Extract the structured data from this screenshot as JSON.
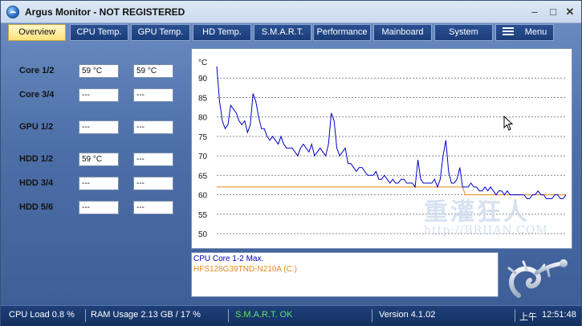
{
  "window": {
    "title": "Argus Monitor - NOT REGISTERED"
  },
  "tabs": [
    {
      "label": "Overview",
      "active": true
    },
    {
      "label": "CPU Temp.",
      "active": false
    },
    {
      "label": "GPU Temp.",
      "active": false
    },
    {
      "label": "HD Temp.",
      "active": false
    },
    {
      "label": "S.M.A.R.T.",
      "active": false
    },
    {
      "label": "Performance",
      "active": false
    },
    {
      "label": "Mainboard",
      "active": false
    },
    {
      "label": "System",
      "active": false
    },
    {
      "label": "Menu",
      "active": false
    }
  ],
  "readings": [
    {
      "label": "Core 1/2",
      "values": [
        "59 °C",
        "59 °C"
      ]
    },
    {
      "label": "Core 3/4",
      "values": [
        "---",
        "---"
      ]
    },
    {
      "label": "GPU 1/2",
      "values": [
        "---",
        "---"
      ]
    },
    {
      "label": "HDD 1/2",
      "values": [
        "59 °C",
        "---"
      ]
    },
    {
      "label": "HDD 3/4",
      "values": [
        "---",
        "---"
      ]
    },
    {
      "label": "HDD 5/6",
      "values": [
        "---",
        "---"
      ]
    }
  ],
  "chart_data": {
    "type": "line",
    "ylabel": "°C",
    "ylim": [
      50,
      95
    ],
    "yticks": [
      50,
      55,
      60,
      65,
      70,
      75,
      80,
      85,
      90
    ],
    "grid": true,
    "series": [
      {
        "name": "CPU Core 1-2 Max.",
        "color": "#0000c8",
        "values": [
          93,
          84,
          79,
          77,
          78,
          83,
          82,
          81,
          79,
          78,
          79,
          76,
          78,
          86,
          84,
          80,
          77,
          77,
          75,
          74,
          75,
          74,
          73,
          75,
          73,
          72,
          72,
          72,
          71,
          70,
          72,
          73,
          72,
          71,
          73,
          70,
          71,
          72,
          71,
          70,
          73,
          81,
          79,
          72,
          70,
          71,
          72,
          68,
          68,
          67,
          66,
          67,
          67,
          66,
          65,
          65,
          65,
          66,
          64,
          64,
          65,
          64,
          63,
          64,
          63,
          63,
          64,
          64,
          63,
          63,
          63,
          62,
          69,
          64,
          63,
          63,
          63,
          63,
          64,
          62,
          64,
          70,
          74,
          66,
          63,
          63,
          64,
          67,
          62,
          62,
          62,
          63,
          62,
          62,
          61,
          61,
          62,
          61,
          62,
          61,
          60,
          61,
          61,
          60,
          61,
          60,
          60,
          60,
          60,
          60,
          60,
          59,
          59,
          60,
          60,
          61,
          60,
          60,
          59,
          59,
          59,
          60,
          60,
          59,
          59,
          60
        ]
      },
      {
        "name": "HFS128G39TND-N210A (C:)",
        "color": "#e8891e",
        "values": [
          62,
          62,
          62,
          62,
          62,
          62,
          62,
          62,
          62,
          62,
          62,
          62,
          62,
          62,
          62,
          62,
          62,
          62,
          62,
          62,
          62,
          62,
          62,
          62,
          62,
          62,
          62,
          62,
          62,
          62,
          62,
          62,
          62,
          62,
          62,
          62,
          62,
          62,
          62,
          62,
          62,
          62,
          62,
          62,
          62,
          62,
          62,
          62,
          62,
          62,
          62,
          62,
          62,
          62,
          62,
          62,
          62,
          62,
          62,
          62,
          62,
          62,
          62,
          62,
          62,
          62,
          62,
          62,
          62,
          62,
          62,
          62,
          62,
          62,
          62,
          62,
          62,
          62,
          62,
          62,
          62,
          62,
          62,
          62,
          62,
          62,
          62,
          62,
          62,
          60,
          60,
          60,
          60,
          60,
          60,
          60,
          60,
          60,
          60,
          60,
          60,
          60,
          60,
          60,
          60,
          60,
          60,
          60,
          60,
          60,
          60,
          60,
          60,
          60,
          60,
          60,
          60,
          60,
          60,
          60,
          60,
          60,
          60,
          60,
          60,
          60
        ]
      }
    ]
  },
  "legend": {
    "cpu": "CPU Core 1-2 Max.",
    "hdd": "HFS128G39TND-N210A (C:)"
  },
  "watermark": {
    "text": "重灌狂人",
    "url": "http://BRIIAN.COM"
  },
  "status": {
    "cpu_load": "CPU Load 0.8 %",
    "ram_usage": "RAM Usage 2.13 GB / 17 %",
    "smart": "S.M.A.R.T. OK",
    "version": "Version 4.1.02",
    "ampm": "上午",
    "time": "12:51:48"
  },
  "colors": {
    "smart_ok": "#5ee36a",
    "active_tab": "#ffe27a"
  }
}
